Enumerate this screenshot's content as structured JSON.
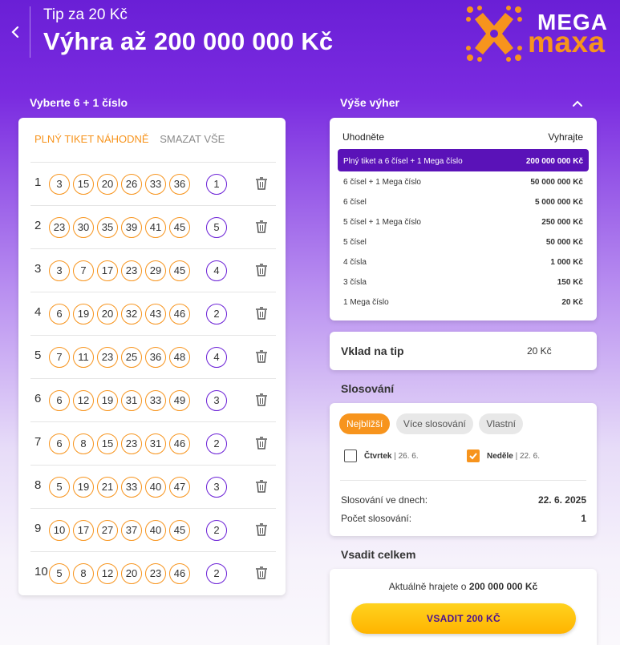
{
  "header": {
    "subtitle": "Tip za 20 Kč",
    "title": "Výhra až 200 000 000 Kč",
    "logo_top": "MEGA",
    "logo_bottom": "maxa"
  },
  "colors": {
    "brand_purple": "#6a1fd6",
    "accent_orange": "#f7941d",
    "button_yellow": "#ffc107"
  },
  "ticket": {
    "section_title": "Vyberte 6 + 1 číslo",
    "random_label": "PLNÝ TIKET NÁHODNĚ",
    "clear_label": "SMAZAT VŠE",
    "rows": [
      {
        "index": "1",
        "numbers": [
          "3",
          "15",
          "20",
          "26",
          "33",
          "36"
        ],
        "mega": "1"
      },
      {
        "index": "2",
        "numbers": [
          "23",
          "30",
          "35",
          "39",
          "41",
          "45"
        ],
        "mega": "5"
      },
      {
        "index": "3",
        "numbers": [
          "3",
          "7",
          "17",
          "23",
          "29",
          "45"
        ],
        "mega": "4"
      },
      {
        "index": "4",
        "numbers": [
          "6",
          "19",
          "20",
          "32",
          "43",
          "46"
        ],
        "mega": "2"
      },
      {
        "index": "5",
        "numbers": [
          "7",
          "11",
          "23",
          "25",
          "36",
          "48"
        ],
        "mega": "4"
      },
      {
        "index": "6",
        "numbers": [
          "6",
          "12",
          "19",
          "31",
          "33",
          "49"
        ],
        "mega": "3"
      },
      {
        "index": "7",
        "numbers": [
          "6",
          "8",
          "15",
          "23",
          "31",
          "46"
        ],
        "mega": "2"
      },
      {
        "index": "8",
        "numbers": [
          "5",
          "19",
          "21",
          "33",
          "40",
          "47"
        ],
        "mega": "3"
      },
      {
        "index": "9",
        "numbers": [
          "10",
          "17",
          "27",
          "37",
          "40",
          "45"
        ],
        "mega": "2"
      },
      {
        "index": "10",
        "numbers": [
          "5",
          "8",
          "12",
          "20",
          "23",
          "46"
        ],
        "mega": "2"
      }
    ]
  },
  "prizes": {
    "section_title": "Výše výher",
    "col_guess": "Uhodněte",
    "col_win": "Vyhrajte",
    "rows": [
      {
        "label": "Plný tiket a 6 čísel + 1 Mega číslo",
        "value": "200 000 000 Kč",
        "active": true
      },
      {
        "label": "6 čísel + 1 Mega číslo",
        "value": "50 000 000 Kč"
      },
      {
        "label": "6 čísel",
        "value": "5 000 000 Kč"
      },
      {
        "label": "5 čísel + 1 Mega číslo",
        "value": "250 000 Kč"
      },
      {
        "label": "5 čísel",
        "value": "50 000 Kč"
      },
      {
        "label": "4 čísla",
        "value": "1 000 Kč"
      },
      {
        "label": "3 čísla",
        "value": "150 Kč"
      },
      {
        "label": "1 Mega číslo",
        "value": "20 Kč"
      }
    ]
  },
  "stake": {
    "label": "Vklad na tip",
    "value": "20 Kč"
  },
  "draws": {
    "section_title": "Slosování",
    "pills": [
      "Nejbližší",
      "Více slosování",
      "Vlastní"
    ],
    "days": [
      {
        "name": "Čtvrtek",
        "date": " | 26. 6.",
        "checked": false
      },
      {
        "name": "Neděle",
        "date": " | 22. 6.",
        "checked": true
      }
    ],
    "days_label": "Slosování ve dnech:",
    "days_value": "22. 6. 2025",
    "count_label": "Počet slosování:",
    "count_value": "1"
  },
  "total": {
    "section_title": "Vsadit celkem",
    "current_prefix": "Aktuálně hrajete o ",
    "current_value": "200 000 000 Kč",
    "bet_button": "VSADIT 200 KČ"
  }
}
